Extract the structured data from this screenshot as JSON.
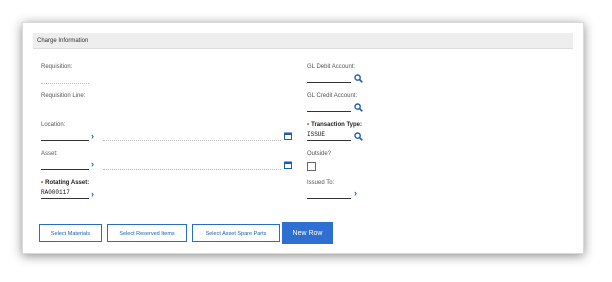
{
  "section": {
    "title": "Charge Information"
  },
  "left": {
    "requisition_label": "Requisition:",
    "requisition_line_label": "Requisition Line:",
    "location_label": "Location:",
    "asset_label": "Asset:",
    "rotating_asset_label": "Rotating Asset:",
    "rotating_asset_value": "RA000117"
  },
  "right": {
    "gl_debit_label": "GL Debit Account:",
    "gl_credit_label": "GL Credit Account:",
    "transaction_type_label": "Transaction Type:",
    "transaction_type_value": "ISSUE",
    "outside_label": "Outside?",
    "issued_to_label": "Issued To:"
  },
  "buttons": {
    "select_materials": "Select Materials",
    "select_reserved_items": "Select Reserved Items",
    "select_asset_spare_parts": "Select Asset Spare Parts",
    "new_row": "New Row"
  },
  "colors": {
    "accent": "#2f6fd1",
    "required": "#d03c00"
  },
  "icons": {
    "search": "search-icon",
    "chevron": "chevron-right-icon",
    "calendar": "calendar-icon"
  }
}
